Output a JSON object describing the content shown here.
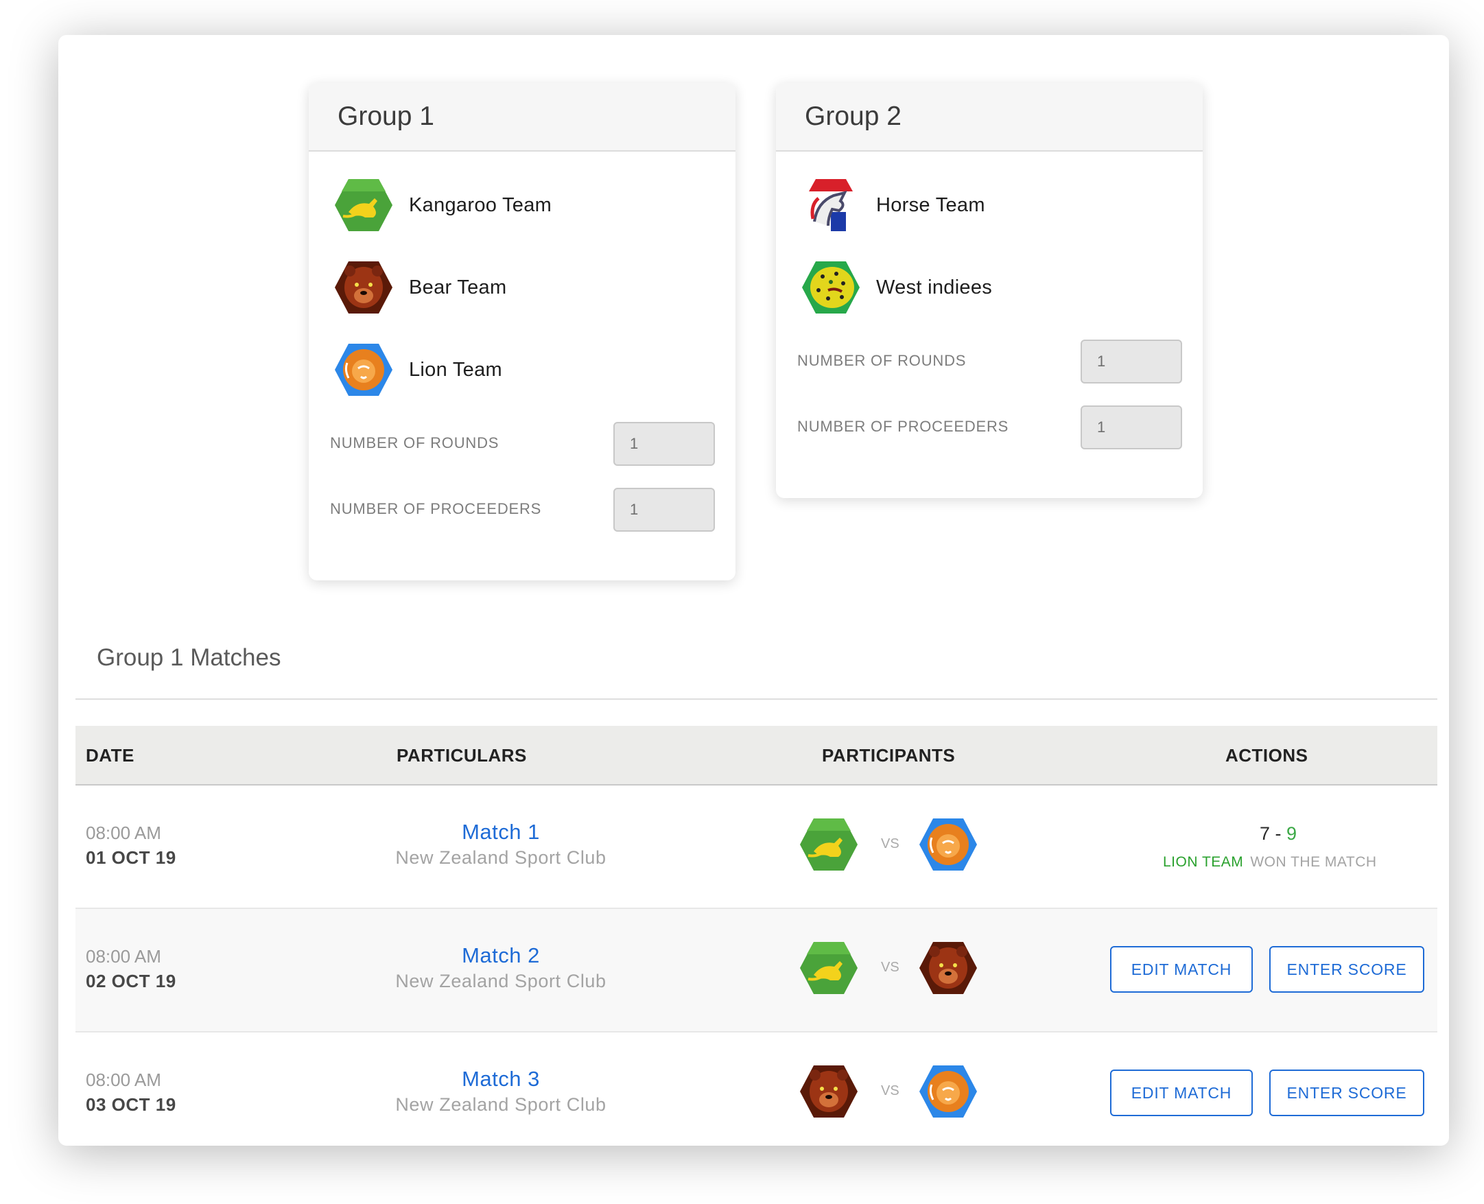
{
  "groups": [
    {
      "title": "Group 1",
      "teams": [
        {
          "name": "Kangaroo Team",
          "icon": "kangaroo-icon"
        },
        {
          "name": "Bear Team",
          "icon": "bear-icon"
        },
        {
          "name": "Lion Team",
          "icon": "lion-icon"
        }
      ],
      "rounds_label": "NUMBER OF ROUNDS",
      "rounds_value": "1",
      "proceeders_label": "NUMBER OF PROCEEDERS",
      "proceeders_value": "1"
    },
    {
      "title": "Group 2",
      "teams": [
        {
          "name": "Horse Team",
          "icon": "horse-icon"
        },
        {
          "name": "West indiees",
          "icon": "leopard-icon"
        }
      ],
      "rounds_label": "NUMBER OF ROUNDS",
      "rounds_value": "1",
      "proceeders_label": "NUMBER OF PROCEEDERS",
      "proceeders_value": "1"
    }
  ],
  "matches": {
    "title": "Group 1 Matches",
    "columns": {
      "date": "DATE",
      "particulars": "PARTICULARS",
      "participants": "PARTICIPANTS",
      "actions": "ACTIONS"
    },
    "rows": [
      {
        "time": "08:00 AM",
        "date": "01 OCT 19",
        "match": "Match 1",
        "venue": "New Zealand Sport Club",
        "home": "kangaroo-icon",
        "vs": "VS",
        "away": "lion-icon",
        "score_home": "7",
        "score_sep": "-",
        "score_away": "9",
        "winner": "LION TEAM",
        "won_text": "WON THE MATCH"
      },
      {
        "time": "08:00 AM",
        "date": "02 OCT 19",
        "match": "Match 2",
        "venue": "New Zealand Sport Club",
        "home": "kangaroo-icon",
        "vs": "VS",
        "away": "bear-icon",
        "edit_label": "EDIT MATCH",
        "score_label": "ENTER SCORE"
      },
      {
        "time": "08:00 AM",
        "date": "03 OCT 19",
        "match": "Match 3",
        "venue": "New Zealand Sport Club",
        "home": "bear-icon",
        "vs": "VS",
        "away": "lion-icon",
        "edit_label": "EDIT MATCH",
        "score_label": "ENTER SCORE"
      }
    ]
  },
  "colors": {
    "link": "#1e6bd6",
    "win": "#2aa12e",
    "kangaroo": "#4aa33a",
    "bear": "#8c2a10",
    "lion": "#e8801e",
    "horse": "#d8202a",
    "leopard": "#d9d11a"
  }
}
